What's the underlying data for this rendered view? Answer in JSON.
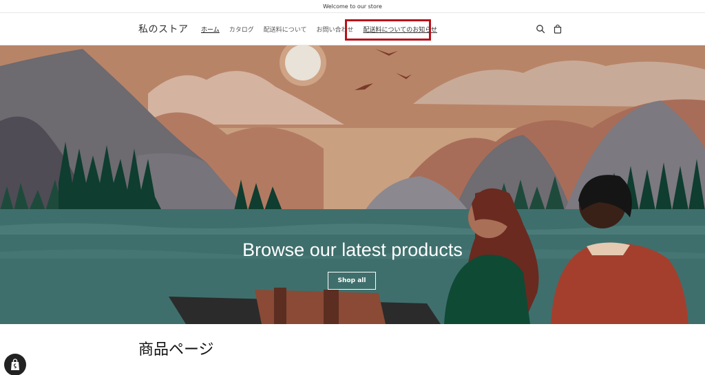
{
  "announcement": "Welcome to our store",
  "header": {
    "logo": "私のストア",
    "nav": [
      {
        "label": "ホーム",
        "active": true
      },
      {
        "label": "カタログ"
      },
      {
        "label": "配送料について"
      },
      {
        "label": "お問い合わせ"
      },
      {
        "label": "配送料についてのお知らせ"
      }
    ],
    "icons": {
      "search": "search-icon",
      "cart": "cart-icon"
    }
  },
  "hero": {
    "title": "Browse our latest products",
    "button": "Shop all"
  },
  "main": {
    "section_title": "商品ページ"
  },
  "colors": {
    "highlight": "#b8111a",
    "sky": "#c79b79",
    "lake": "#3f6f6c"
  }
}
